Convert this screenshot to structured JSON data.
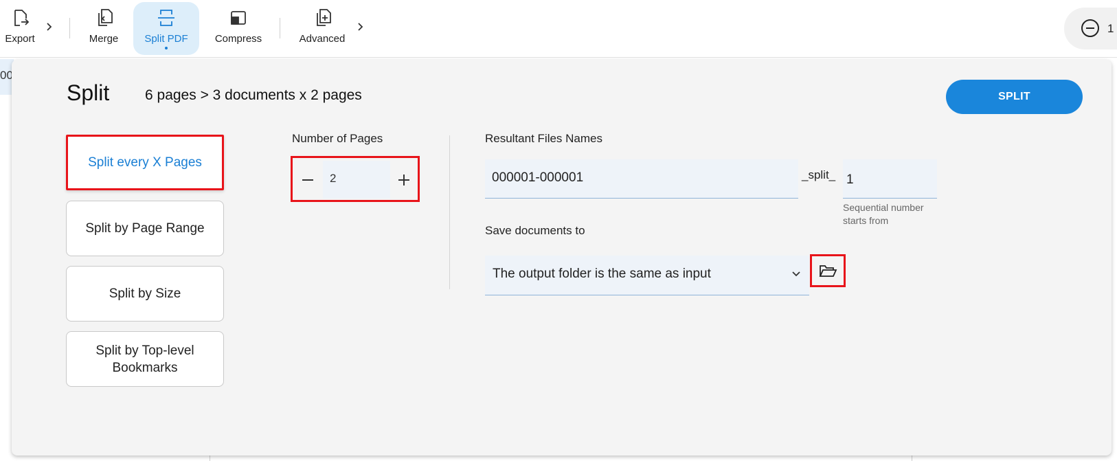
{
  "toolbar": {
    "export_label": "Export",
    "merge_label": "Merge",
    "split_label": "Split PDF",
    "compress_label": "Compress",
    "advanced_label": "Advanced",
    "zoom_value": "1"
  },
  "background": {
    "left_strip_text": "00"
  },
  "panel": {
    "title": "Split",
    "summary": "6 pages > 3 documents x 2 pages",
    "split_button_label": "SPLIT",
    "modes": [
      {
        "label": "Split every X Pages",
        "selected": true
      },
      {
        "label": "Split by Page Range",
        "selected": false
      },
      {
        "label": "Split by Size",
        "selected": false
      },
      {
        "label": "Split by Top-level Bookmarks",
        "selected": false
      }
    ],
    "number_of_pages": {
      "label": "Number of Pages",
      "value": "2"
    },
    "resultant_names": {
      "label": "Resultant Files Names",
      "base_name": "000001-000001",
      "suffix": "_split_",
      "sequence_start": "1",
      "sequence_hint": "Sequential number starts from"
    },
    "save_to": {
      "label": "Save documents to",
      "selected": "The output folder is the same as input"
    }
  },
  "colors": {
    "accent": "#1a86db",
    "highlight_border": "#e8141a",
    "active_tab_bg": "#ddeefa"
  }
}
